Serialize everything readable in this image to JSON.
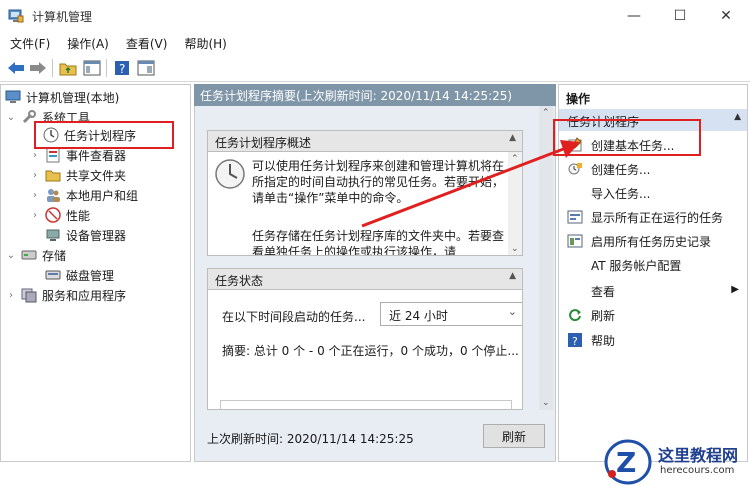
{
  "window": {
    "title": "计算机管理",
    "controls": {
      "minimize": "—",
      "maximize": "☐",
      "close": "✕"
    }
  },
  "menu": [
    "文件(F)",
    "操作(A)",
    "查看(V)",
    "帮助(H)"
  ],
  "tree": {
    "root": "计算机管理(本地)",
    "system_tools": "系统工具",
    "task_scheduler": "任务计划程序",
    "event_viewer": "事件查看器",
    "shared_folders": "共享文件夹",
    "local_users": "本地用户和组",
    "performance": "性能",
    "device_manager": "设备管理器",
    "storage": "存储",
    "disk_management": "磁盘管理",
    "services_apps": "服务和应用程序"
  },
  "middle": {
    "header": "任务计划程序摘要(上次刷新时间: 2020/11/14 14:25:25)",
    "overview_title": "任务计划程序概述",
    "overview_text_1": "可以使用任务计划程序来创建和管理计算机将在所指定的时间自动执行的常见任务。若要开始，请单击“操作”菜单中的命令。",
    "overview_text_2": "任务存储在任务计划程序库的文件夹中。若要查看单独任务上的操作或执行该操作，请",
    "status_title": "任务状态",
    "status_label": "在以下时间段启动的任务...",
    "status_period": "近 24 小时",
    "summary": "摘要: 总计 0 个 - 0 个正在运行，0 个成功，0 个停止...",
    "last_refresh": "上次刷新时间: 2020/11/14 14:25:25",
    "refresh_button": "刷新"
  },
  "actions": {
    "title": "操作",
    "section": "任务计划程序",
    "items": [
      "创建基本任务...",
      "创建任务...",
      "导入任务...",
      "显示所有正在运行的任务",
      "启用所有任务历史记录",
      "AT 服务帐户配置",
      "查看",
      "刷新",
      "帮助"
    ]
  },
  "watermark": {
    "name": "这里教程网",
    "url": "herecours.com"
  },
  "colors": {
    "annotation_red": "#e02020",
    "mid_header_bg": "#7f95a8",
    "action_section_bg": "#d6e2f2"
  }
}
